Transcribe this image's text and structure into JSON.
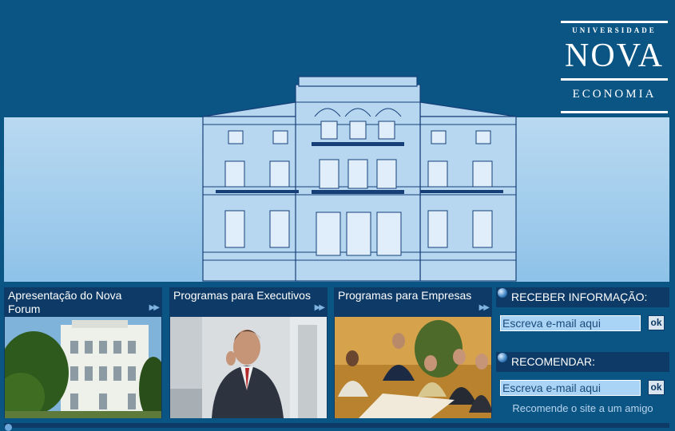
{
  "logo": {
    "line1": "UNIVERSIDADE",
    "line2": "NOVA",
    "line3": "ECONOMIA"
  },
  "panels": [
    {
      "title": "Apresentação do Nova Forum",
      "arrow_icon": "double-chevron-right"
    },
    {
      "title": "Programas para Executivos",
      "arrow_icon": "double-chevron-right"
    },
    {
      "title": "Programas para Empresas",
      "arrow_icon": "double-chevron-right"
    }
  ],
  "sidebar": {
    "receive": {
      "label": "RECEBER INFORMAÇÃO:",
      "placeholder": "Escreva e-mail aqui",
      "button": "ok"
    },
    "recommend": {
      "label": "RECOMENDAR:",
      "placeholder": "Escreva e-mail aqui",
      "button": "ok"
    },
    "recommend_link": "Recomende o site a um amigo"
  },
  "colors": {
    "background": "#0b5585",
    "panel": "#0d3a66",
    "sky": "#a9d4f5",
    "input": "#a9d4f5"
  }
}
